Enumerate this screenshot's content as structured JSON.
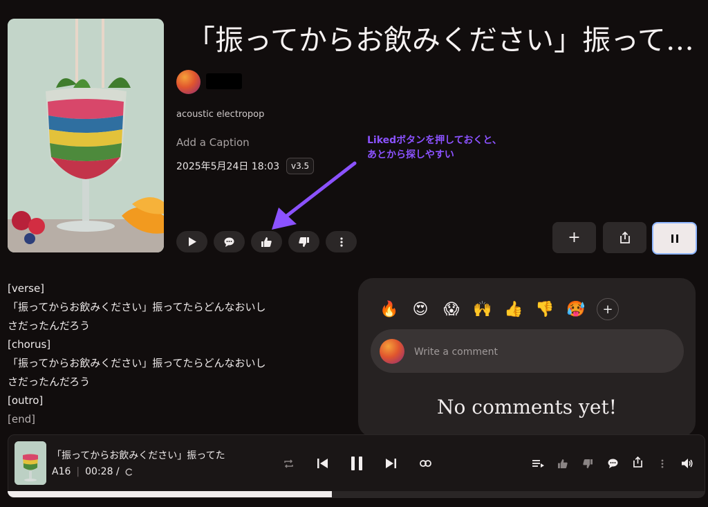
{
  "song": {
    "title": "「振ってからお飲みください」振ってたらどんなおいしさだったんだろう",
    "genre": "acoustic electropop",
    "caption_placeholder": "Add a Caption",
    "date": "2025年5月24日 18:03",
    "version": "v3.5"
  },
  "annotation": {
    "line1": "Likedボタンを押しておくと、",
    "line2": "あとから探しやすい",
    "color": "#8b52ff"
  },
  "actions": {
    "play": "play-icon",
    "comment": "comment-icon",
    "like": "thumbs-up-icon",
    "dislike": "thumbs-down-icon",
    "more": "more-icon",
    "add": "+",
    "share": "share-icon",
    "pause": "pause-icon"
  },
  "lyrics": [
    {
      "text": "[verse]",
      "dim": false
    },
    {
      "text": "「振ってからお飲みください」振ってたらどんなおいし",
      "dim": false
    },
    {
      "text": "さだったんだろう",
      "dim": false
    },
    {
      "text": "[chorus]",
      "dim": false
    },
    {
      "text": "「振ってからお飲みください」振ってたらどんなおいし",
      "dim": false
    },
    {
      "text": "さだったんだろう",
      "dim": false
    },
    {
      "text": "[outro]",
      "dim": false
    },
    {
      "text": "[end]",
      "dim": true
    }
  ],
  "comments": {
    "reactions": [
      "🔥",
      "😍",
      "😱",
      "🙌",
      "👍",
      "👎",
      "🥵"
    ],
    "add_reaction": "+",
    "input_placeholder": "Write a comment",
    "empty_text": "No comments yet!"
  },
  "player": {
    "title": "「振ってからお飲みください」振ってた",
    "artist": "A16",
    "time": "00:28 /",
    "progress": 0.465
  }
}
